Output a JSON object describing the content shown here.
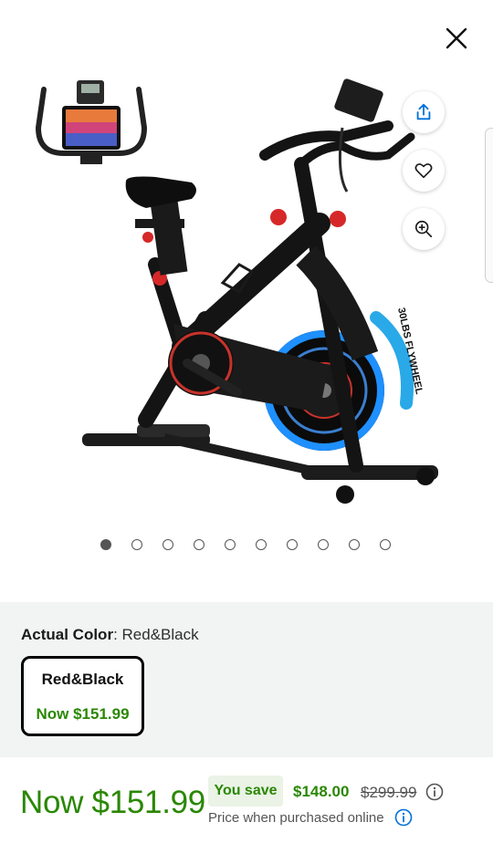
{
  "icons": {
    "close": "close-icon",
    "share": "share-icon",
    "favorite": "heart-icon",
    "zoom": "zoom-in-icon",
    "info": "info-icon"
  },
  "gallery": {
    "image_count": 10,
    "active_index": 0,
    "flywheel_label": "30LBS FLYWHEEL"
  },
  "color": {
    "label": "Actual Color",
    "separator": ": ",
    "value": "Red&Black",
    "option": {
      "name": "Red&Black",
      "price": "Now $151.99"
    }
  },
  "price": {
    "now": "Now $151.99",
    "save_label": "You save",
    "save_amount": "$148.00",
    "was": "$299.99",
    "note": "Price when purchased online"
  },
  "colors": {
    "green": "#2a8703",
    "panel": "#f2f3f3",
    "badge": "#eaf3e6",
    "info_blue": "#0071dc",
    "accent_red": "#d62828",
    "accent_blue": "#1e90ff"
  }
}
